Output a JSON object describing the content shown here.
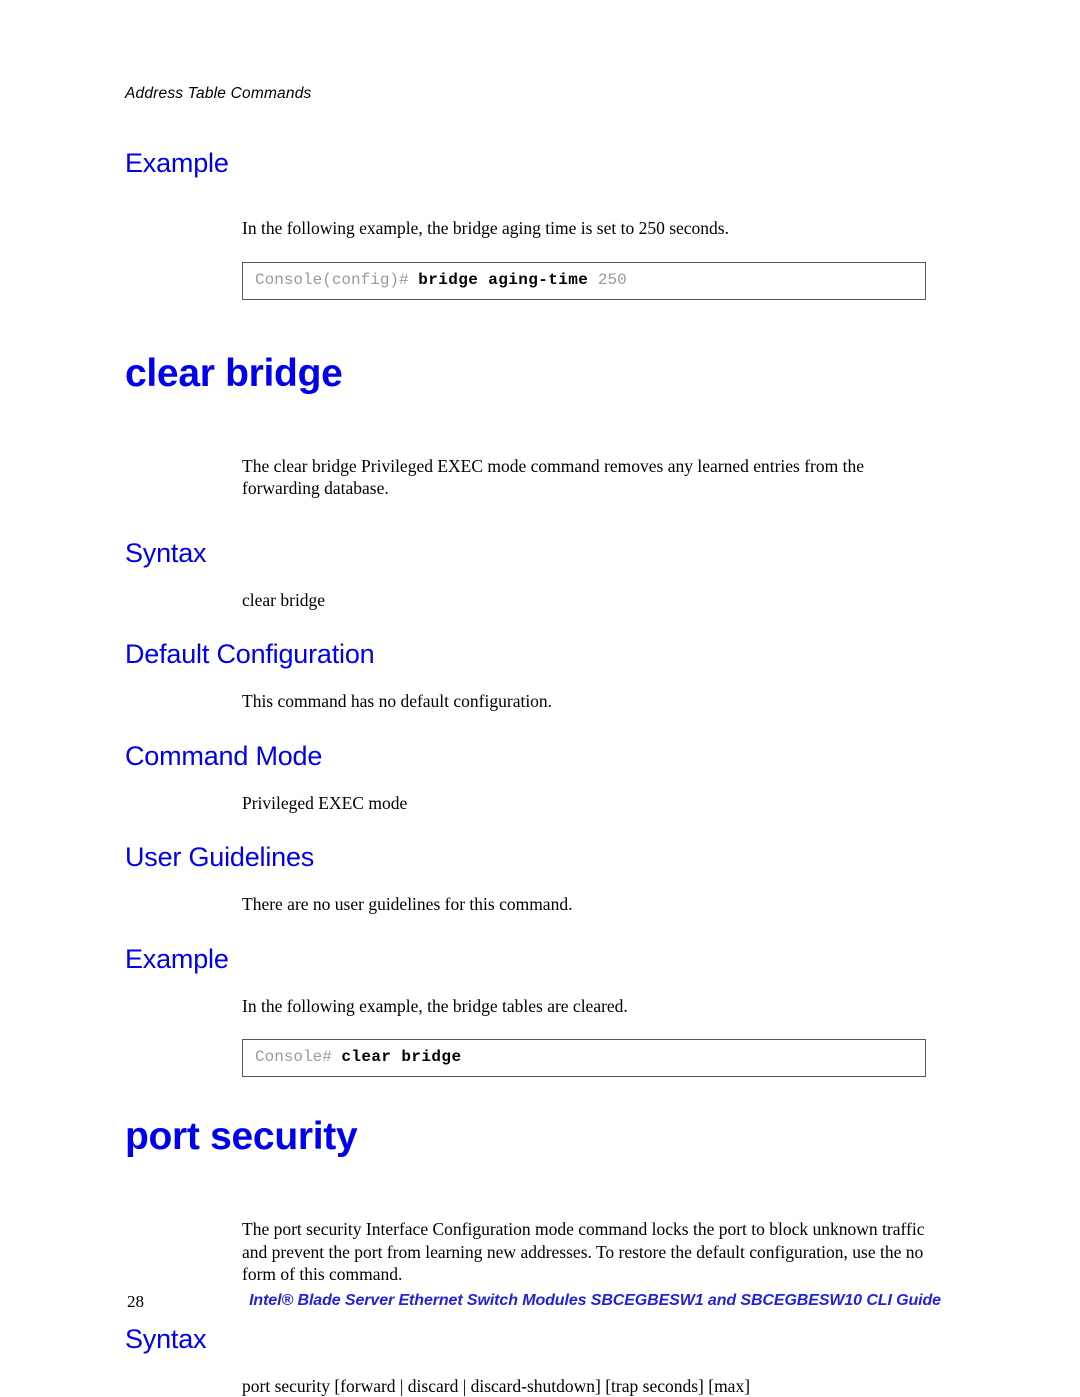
{
  "header": {
    "running_head": "Address Table Commands"
  },
  "sections": [
    {
      "type": "section_heading",
      "label": "Example"
    },
    {
      "type": "paragraph",
      "text": "In the following example, the bridge aging time is set to 250 seconds."
    },
    {
      "type": "console",
      "prompt": "Console(config)#",
      "command": "bridge aging-time",
      "argument": "250"
    }
  ],
  "command_clear_bridge": {
    "title": "clear bridge",
    "description": "The clear bridge Privileged EXEC mode command removes any learned entries from the forwarding database.",
    "syntax_heading": "Syntax",
    "syntax_text": "clear bridge",
    "default_config_heading": "Default Configuration",
    "default_config_text": "This command has no default configuration.",
    "command_mode_heading": "Command Mode",
    "command_mode_text": "Privileged EXEC mode",
    "user_guidelines_heading": "User Guidelines",
    "user_guidelines_text": "There are no user guidelines for this command.",
    "example_heading": "Example",
    "example_text": "In the following example, the bridge tables are cleared.",
    "example_console": {
      "prompt": "Console#",
      "command": "clear bridge",
      "argument": ""
    }
  },
  "command_port_security": {
    "title": "port security",
    "description": "The port security Interface Configuration mode command locks the port to block unknown traffic and prevent the port from learning new addresses. To restore the default configuration, use the no form of this command.",
    "syntax_heading": "Syntax",
    "syntax_text": "port security [forward | discard | discard-shutdown] [trap seconds] [max]"
  },
  "footer": {
    "page_number": "28",
    "document_title": "Intel® Blade Server Ethernet Switch Modules SBCEGBESW1 and SBCEGBESW10 CLI Guide"
  },
  "colors": {
    "heading_blue": "#0000EE",
    "footer_blue": "#2222DD",
    "console_border": "#58585a",
    "console_gray_text": "#9a9a9a"
  }
}
